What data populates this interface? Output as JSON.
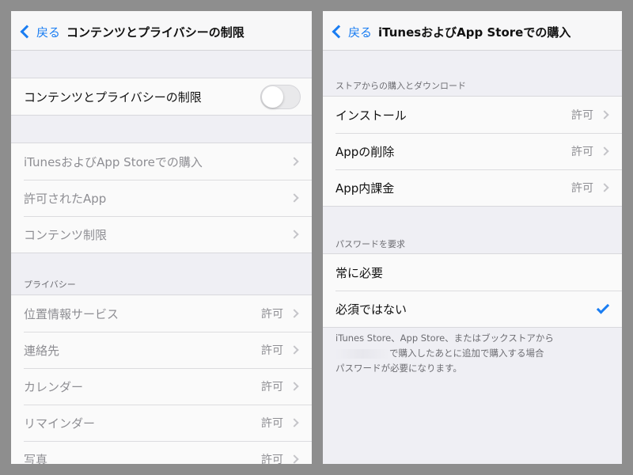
{
  "left": {
    "nav": {
      "back_label": "戻る",
      "title": "コンテンツとプライバシーの制限"
    },
    "toggle_row": {
      "label": "コンテンツとプライバシーの制限",
      "state": "off"
    },
    "items": [
      {
        "label": "iTunesおよびApp Storeでの購入"
      },
      {
        "label": "許可されたApp"
      },
      {
        "label": "コンテンツ制限"
      }
    ],
    "privacy": {
      "header": "プライバシー",
      "items": [
        {
          "label": "位置情報サービス",
          "value": "許可"
        },
        {
          "label": "連絡先",
          "value": "許可"
        },
        {
          "label": "カレンダー",
          "value": "許可"
        },
        {
          "label": "リマインダー",
          "value": "許可"
        },
        {
          "label": "写真",
          "value": "許可"
        }
      ]
    }
  },
  "right": {
    "nav": {
      "back_label": "戻る",
      "title": "iTunesおよびApp Storeでの購入"
    },
    "store": {
      "header": "ストアからの購入とダウンロード",
      "items": [
        {
          "label": "インストール",
          "value": "許可"
        },
        {
          "label": "Appの削除",
          "value": "許可"
        },
        {
          "label": "App内課金",
          "value": "許可"
        }
      ]
    },
    "password": {
      "header": "パスワードを要求",
      "items": [
        {
          "label": "常に必要",
          "checked": false
        },
        {
          "label": "必須ではない",
          "checked": true
        }
      ]
    },
    "footer": {
      "line1": "iTunes Store、App Store、またはブックストアから",
      "line2": "で購入したあとに追加で購入する場合",
      "line3": "パスワードが必要になります。"
    }
  },
  "colors": {
    "accent": "#1a7df2",
    "background": "#efeff4",
    "outer": "#8e8e8e"
  }
}
